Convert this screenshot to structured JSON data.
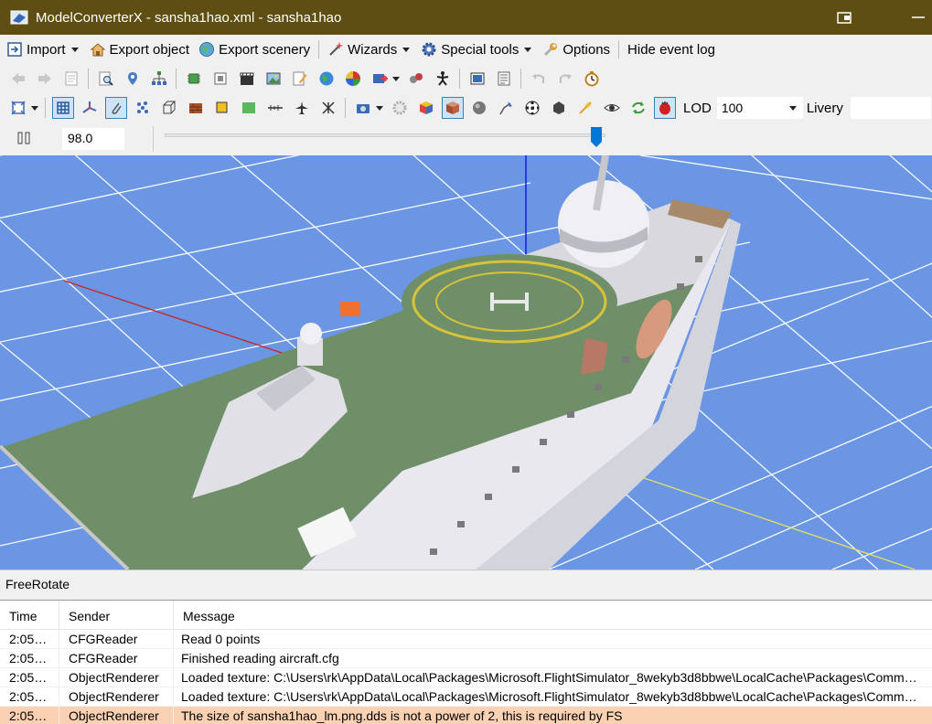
{
  "window": {
    "title": "ModelConverterX - sansha1hao.xml - sansha1hao",
    "app_icon": "modelconverterx-logo-icon",
    "restore_icon": "restore-window-icon",
    "minimize_icon": "minimize-icon"
  },
  "menu": {
    "import": "Import",
    "export_object": "Export object",
    "export_scenery": "Export scenery",
    "wizards": "Wizards",
    "special_tools": "Special tools",
    "options": "Options",
    "hide_event_log": "Hide event log"
  },
  "toolbar2": {
    "lod_label": "LOD",
    "lod_value": "100",
    "livery_label": "Livery"
  },
  "slider": {
    "value": "98.0",
    "position_fraction": 0.98
  },
  "status": {
    "mode": "FreeRotate"
  },
  "event_log": {
    "columns": [
      "Time",
      "Sender",
      "Message"
    ],
    "rows": [
      {
        "time": "2:05:2...",
        "sender": "CFGReader",
        "message": "Read 0 points",
        "selected": false
      },
      {
        "time": "2:05:2...",
        "sender": "CFGReader",
        "message": "Finished reading aircraft.cfg",
        "selected": false
      },
      {
        "time": "2:05:2...",
        "sender": "ObjectRenderer",
        "message": "Loaded texture: C:\\Users\\rk\\AppData\\Local\\Packages\\Microsoft.FlightSimulator_8wekyb3d8bbwe\\LocalCache\\Packages\\Community\\...",
        "selected": false
      },
      {
        "time": "2:05:2...",
        "sender": "ObjectRenderer",
        "message": "Loaded texture: C:\\Users\\rk\\AppData\\Local\\Packages\\Microsoft.FlightSimulator_8wekyb3d8bbwe\\LocalCache\\Packages\\Community\\...",
        "selected": false
      },
      {
        "time": "2:05:2...",
        "sender": "ObjectRenderer",
        "message": "The size of sansha1hao_lm.png.dds is not a power of 2, this is required by FS",
        "selected": true
      }
    ]
  },
  "colors": {
    "titlebar": "#5e4e12",
    "viewport_bg": "#6a96e4",
    "grid_lines": "#ffffff",
    "selected_row": "#fad1b2",
    "deck_green": "#6d8f66",
    "hull_white": "#ececf0",
    "helipad_yellow": "#d6c23b"
  }
}
